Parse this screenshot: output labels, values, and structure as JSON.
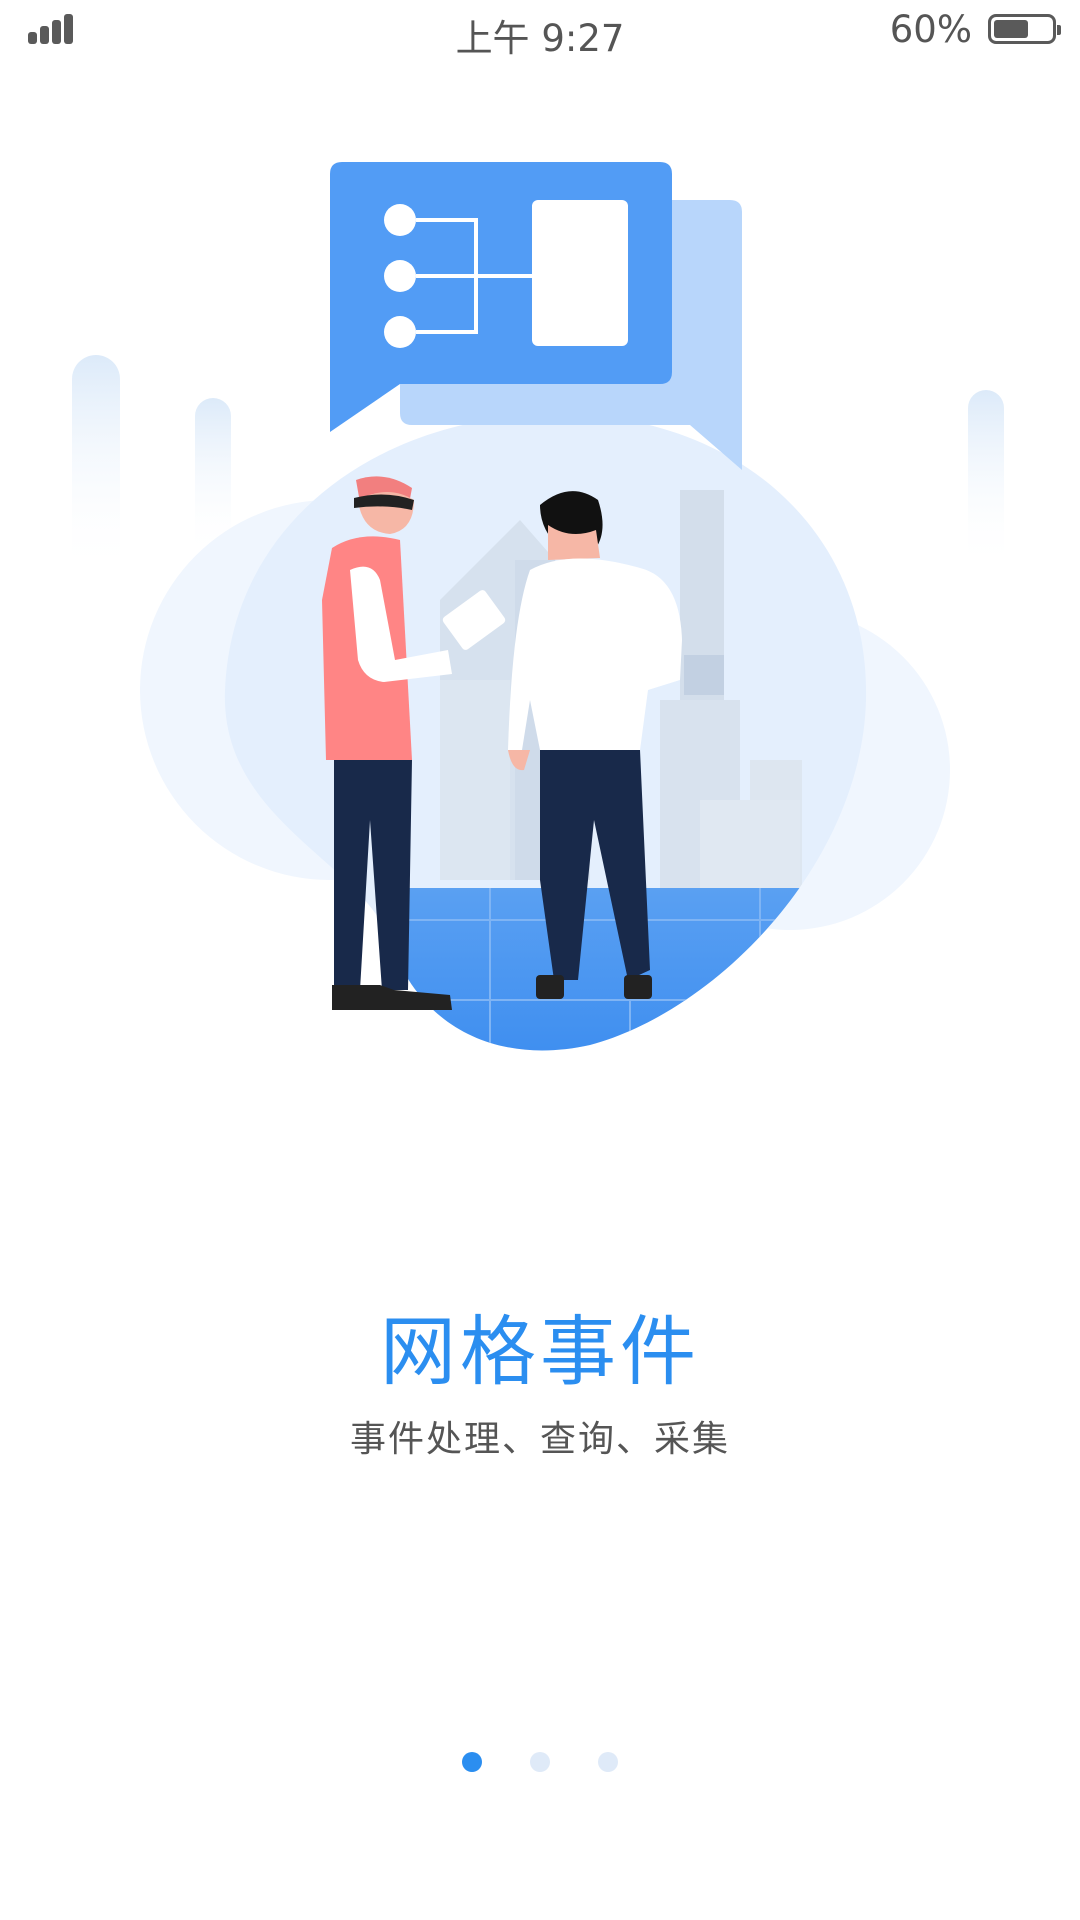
{
  "status_bar": {
    "time": "上午 9:27",
    "battery_percent_label": "60%",
    "battery_level": 0.6,
    "signal_bars": 4
  },
  "onboarding": {
    "title": "网格事件",
    "subtitle": "事件处理、查询、采集",
    "current_page": 1,
    "total_pages": 3
  },
  "colors": {
    "accent": "#2b8ef0",
    "dot_inactive": "#dfeaf8",
    "text_secondary": "#555555"
  },
  "icons": {
    "signal": "signal-strength-icon",
    "battery": "battery-icon"
  }
}
